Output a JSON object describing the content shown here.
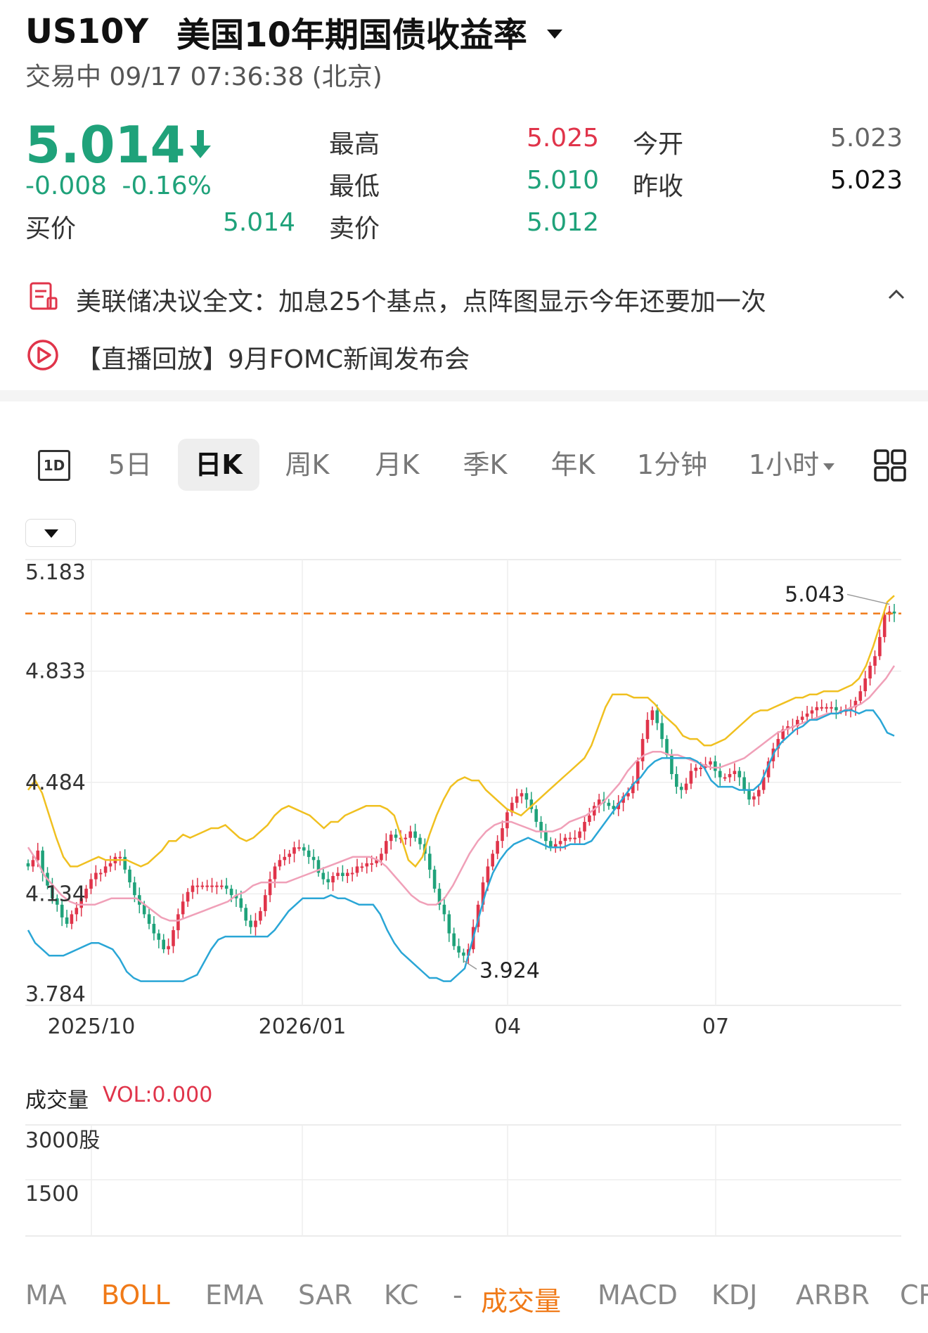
{
  "header": {
    "symbol": "US10Y",
    "name": "美国10年期国债收益率",
    "status": "交易中 09/17 07:36:38 (北京)"
  },
  "quote": {
    "price": "5.014",
    "change": "-0.008",
    "change_pct": "-0.16%",
    "high_label": "最高",
    "high": "5.025",
    "open_label": "今开",
    "open": "5.023",
    "low_label": "最低",
    "low": "5.010",
    "prev_label": "昨收",
    "prev": "5.023",
    "bid_label": "买价",
    "bid": "5.014",
    "ask_label": "卖价",
    "ask": "5.012"
  },
  "news": [
    {
      "text": "美联储决议全文：加息25个基点，点阵图显示今年还要加一次",
      "icon": "document-icon"
    },
    {
      "text": "【直播回放】9月FOMC新闻发布会",
      "icon": "play-icon"
    }
  ],
  "tabs": {
    "icon_1d": "1D",
    "items": [
      "5日",
      "日K",
      "周K",
      "月K",
      "季K",
      "年K",
      "1分钟",
      "1小时"
    ],
    "active": "日K"
  },
  "chart_data": {
    "type": "candlestick",
    "y_ticks": [
      "5.183",
      "4.833",
      "4.484",
      "4.134",
      "3.784"
    ],
    "ylim": [
      3.784,
      5.183
    ],
    "x_ticks": [
      "2025/10",
      "2026/01",
      "04",
      "07"
    ],
    "price_line": 5.014,
    "max_label": "5.043",
    "min_label": "3.924",
    "indicator": "BOLL",
    "grid": true,
    "colors": {
      "up": "#e0344a",
      "down": "#1fa27a",
      "upper": "#f0c020",
      "middle": "#f0a0b8",
      "lower": "#2aa6d6",
      "price_line": "#f07a18"
    },
    "series": [
      {
        "name": "close",
        "values": [
          4.22,
          4.24,
          4.27,
          4.2,
          4.16,
          4.12,
          4.1,
          4.06,
          4.04,
          4.07,
          4.09,
          4.12,
          4.15,
          4.18,
          4.2,
          4.2,
          4.22,
          4.23,
          4.25,
          4.25,
          4.21,
          4.17,
          4.13,
          4.1,
          4.07,
          4.04,
          4.01,
          3.99,
          3.96,
          3.97,
          4.02,
          4.07,
          4.11,
          4.14,
          4.16,
          4.16,
          4.16,
          4.16,
          4.16,
          4.16,
          4.16,
          4.15,
          4.13,
          4.12,
          4.09,
          4.05,
          4.03,
          4.05,
          4.08,
          4.13,
          4.18,
          4.22,
          4.24,
          4.25,
          4.26,
          4.28,
          4.28,
          4.27,
          4.25,
          4.24,
          4.2,
          4.18,
          4.17,
          4.19,
          4.2,
          4.19,
          4.2,
          4.2,
          4.22,
          4.22,
          4.23,
          4.23,
          4.24,
          4.26,
          4.3,
          4.32,
          4.31,
          4.31,
          4.31,
          4.33,
          4.31,
          4.29,
          4.26,
          4.21,
          4.15,
          4.1,
          4.07,
          4.01,
          3.97,
          3.95,
          3.94,
          3.96,
          4.03,
          4.1,
          4.17,
          4.22,
          4.26,
          4.3,
          4.34,
          4.39,
          4.42,
          4.44,
          4.45,
          4.43,
          4.4,
          4.36,
          4.33,
          4.3,
          4.28,
          4.29,
          4.3,
          4.31,
          4.31,
          4.31,
          4.33,
          4.36,
          4.38,
          4.41,
          4.43,
          4.42,
          4.41,
          4.4,
          4.42,
          4.44,
          4.45,
          4.48,
          4.55,
          4.62,
          4.68,
          4.71,
          4.67,
          4.62,
          4.57,
          4.51,
          4.47,
          4.46,
          4.48,
          4.52,
          4.53,
          4.53,
          4.54,
          4.55,
          4.52,
          4.5,
          4.5,
          4.51,
          4.52,
          4.5,
          4.46,
          4.43,
          4.44,
          4.46,
          4.5,
          4.55,
          4.59,
          4.62,
          4.65,
          4.66,
          4.66,
          4.68,
          4.69,
          4.7,
          4.71,
          4.72,
          4.72,
          4.72,
          4.72,
          4.71,
          4.71,
          4.71,
          4.72,
          4.74,
          4.77,
          4.81,
          4.85,
          4.88,
          4.94,
          5.01,
          5.02,
          5.014
        ]
      },
      {
        "name": "upper",
        "values": [
          4.46,
          4.49,
          4.45,
          4.38,
          4.31,
          4.25,
          4.22,
          4.22,
          4.23,
          4.24,
          4.25,
          4.24,
          4.24,
          4.24,
          4.24,
          4.23,
          4.22,
          4.23,
          4.25,
          4.27,
          4.3,
          4.3,
          4.32,
          4.31,
          4.32,
          4.33,
          4.34,
          4.34,
          4.35,
          4.33,
          4.31,
          4.3,
          4.31,
          4.33,
          4.35,
          4.38,
          4.4,
          4.41,
          4.4,
          4.39,
          4.38,
          4.36,
          4.34,
          4.36,
          4.36,
          4.38,
          4.39,
          4.4,
          4.41,
          4.41,
          4.41,
          4.4,
          4.38,
          4.31,
          4.24,
          4.22,
          4.25,
          4.32,
          4.38,
          4.43,
          4.47,
          4.49,
          4.5,
          4.49,
          4.49,
          4.46,
          4.44,
          4.42,
          4.4,
          4.39,
          4.38,
          4.4,
          4.42,
          4.44,
          4.46,
          4.48,
          4.5,
          4.52,
          4.54,
          4.56,
          4.6,
          4.66,
          4.72,
          4.76,
          4.76,
          4.76,
          4.75,
          4.75,
          4.75,
          4.73,
          4.7,
          4.68,
          4.66,
          4.63,
          4.62,
          4.62,
          4.6,
          4.6,
          4.61,
          4.62,
          4.64,
          4.66,
          4.68,
          4.7,
          4.71,
          4.71,
          4.72,
          4.73,
          4.74,
          4.75,
          4.75,
          4.76,
          4.76,
          4.77,
          4.77,
          4.77,
          4.78,
          4.79,
          4.81,
          4.85,
          4.91,
          4.98,
          5.05,
          5.07
        ]
      },
      {
        "name": "lower",
        "values": [
          4.02,
          3.98,
          3.96,
          3.94,
          3.94,
          3.94,
          3.95,
          3.96,
          3.97,
          3.98,
          3.98,
          3.97,
          3.96,
          3.93,
          3.89,
          3.87,
          3.86,
          3.86,
          3.86,
          3.86,
          3.86,
          3.86,
          3.86,
          3.87,
          3.88,
          3.92,
          3.96,
          3.99,
          4.0,
          4.0,
          4.0,
          4.0,
          4.0,
          4.0,
          4.0,
          4.02,
          4.05,
          4.08,
          4.1,
          4.12,
          4.12,
          4.12,
          4.12,
          4.13,
          4.12,
          4.12,
          4.11,
          4.1,
          4.1,
          4.1,
          4.07,
          4.02,
          3.98,
          3.95,
          3.93,
          3.91,
          3.89,
          3.87,
          3.87,
          3.86,
          3.86,
          3.88,
          3.9,
          3.98,
          4.06,
          4.14,
          4.2,
          4.24,
          4.27,
          4.29,
          4.3,
          4.31,
          4.3,
          4.29,
          4.28,
          4.28,
          4.28,
          4.29,
          4.29,
          4.29,
          4.3,
          4.33,
          4.36,
          4.39,
          4.42,
          4.45,
          4.48,
          4.5,
          4.53,
          4.55,
          4.56,
          4.56,
          4.56,
          4.56,
          4.56,
          4.55,
          4.53,
          4.49,
          4.47,
          4.47,
          4.47,
          4.46,
          4.46,
          4.46,
          4.48,
          4.53,
          4.58,
          4.61,
          4.63,
          4.65,
          4.66,
          4.68,
          4.68,
          4.69,
          4.7,
          4.7,
          4.71,
          4.71,
          4.7,
          4.71,
          4.71,
          4.68,
          4.64,
          4.63
        ]
      },
      {
        "name": "middle",
        "values": [
          4.28,
          4.24,
          4.19,
          4.16,
          4.13,
          4.11,
          4.1,
          4.1,
          4.1,
          4.11,
          4.12,
          4.12,
          4.12,
          4.12,
          4.1,
          4.08,
          4.06,
          4.05,
          4.05,
          4.06,
          4.07,
          4.08,
          4.09,
          4.1,
          4.11,
          4.13,
          4.14,
          4.16,
          4.17,
          4.17,
          4.17,
          4.17,
          4.18,
          4.19,
          4.2,
          4.21,
          4.22,
          4.23,
          4.24,
          4.25,
          4.25,
          4.25,
          4.24,
          4.22,
          4.19,
          4.16,
          4.13,
          4.11,
          4.1,
          4.1,
          4.12,
          4.16,
          4.21,
          4.26,
          4.3,
          4.33,
          4.35,
          4.36,
          4.36,
          4.35,
          4.34,
          4.33,
          4.33,
          4.33,
          4.34,
          4.36,
          4.37,
          4.38,
          4.4,
          4.42,
          4.45,
          4.48,
          4.52,
          4.55,
          4.57,
          4.58,
          4.58,
          4.57,
          4.57,
          4.56,
          4.55,
          4.54,
          4.53,
          4.53,
          4.54,
          4.55,
          4.56,
          4.58,
          4.6,
          4.62,
          4.64,
          4.65,
          4.66,
          4.67,
          4.68,
          4.69,
          4.7,
          4.7,
          4.71,
          4.72,
          4.73,
          4.75,
          4.78,
          4.81,
          4.85
        ]
      }
    ]
  },
  "volume": {
    "title": "成交量",
    "value": "VOL:0.000",
    "y_ticks": [
      "3000股",
      "1500"
    ]
  },
  "indicators": {
    "items": [
      "MA",
      "BOLL",
      "EMA",
      "SAR",
      "KC",
      "-",
      "成交量",
      "MACD",
      "KDJ",
      "ARBR",
      "CR"
    ],
    "active": [
      "BOLL",
      "成交量"
    ]
  }
}
